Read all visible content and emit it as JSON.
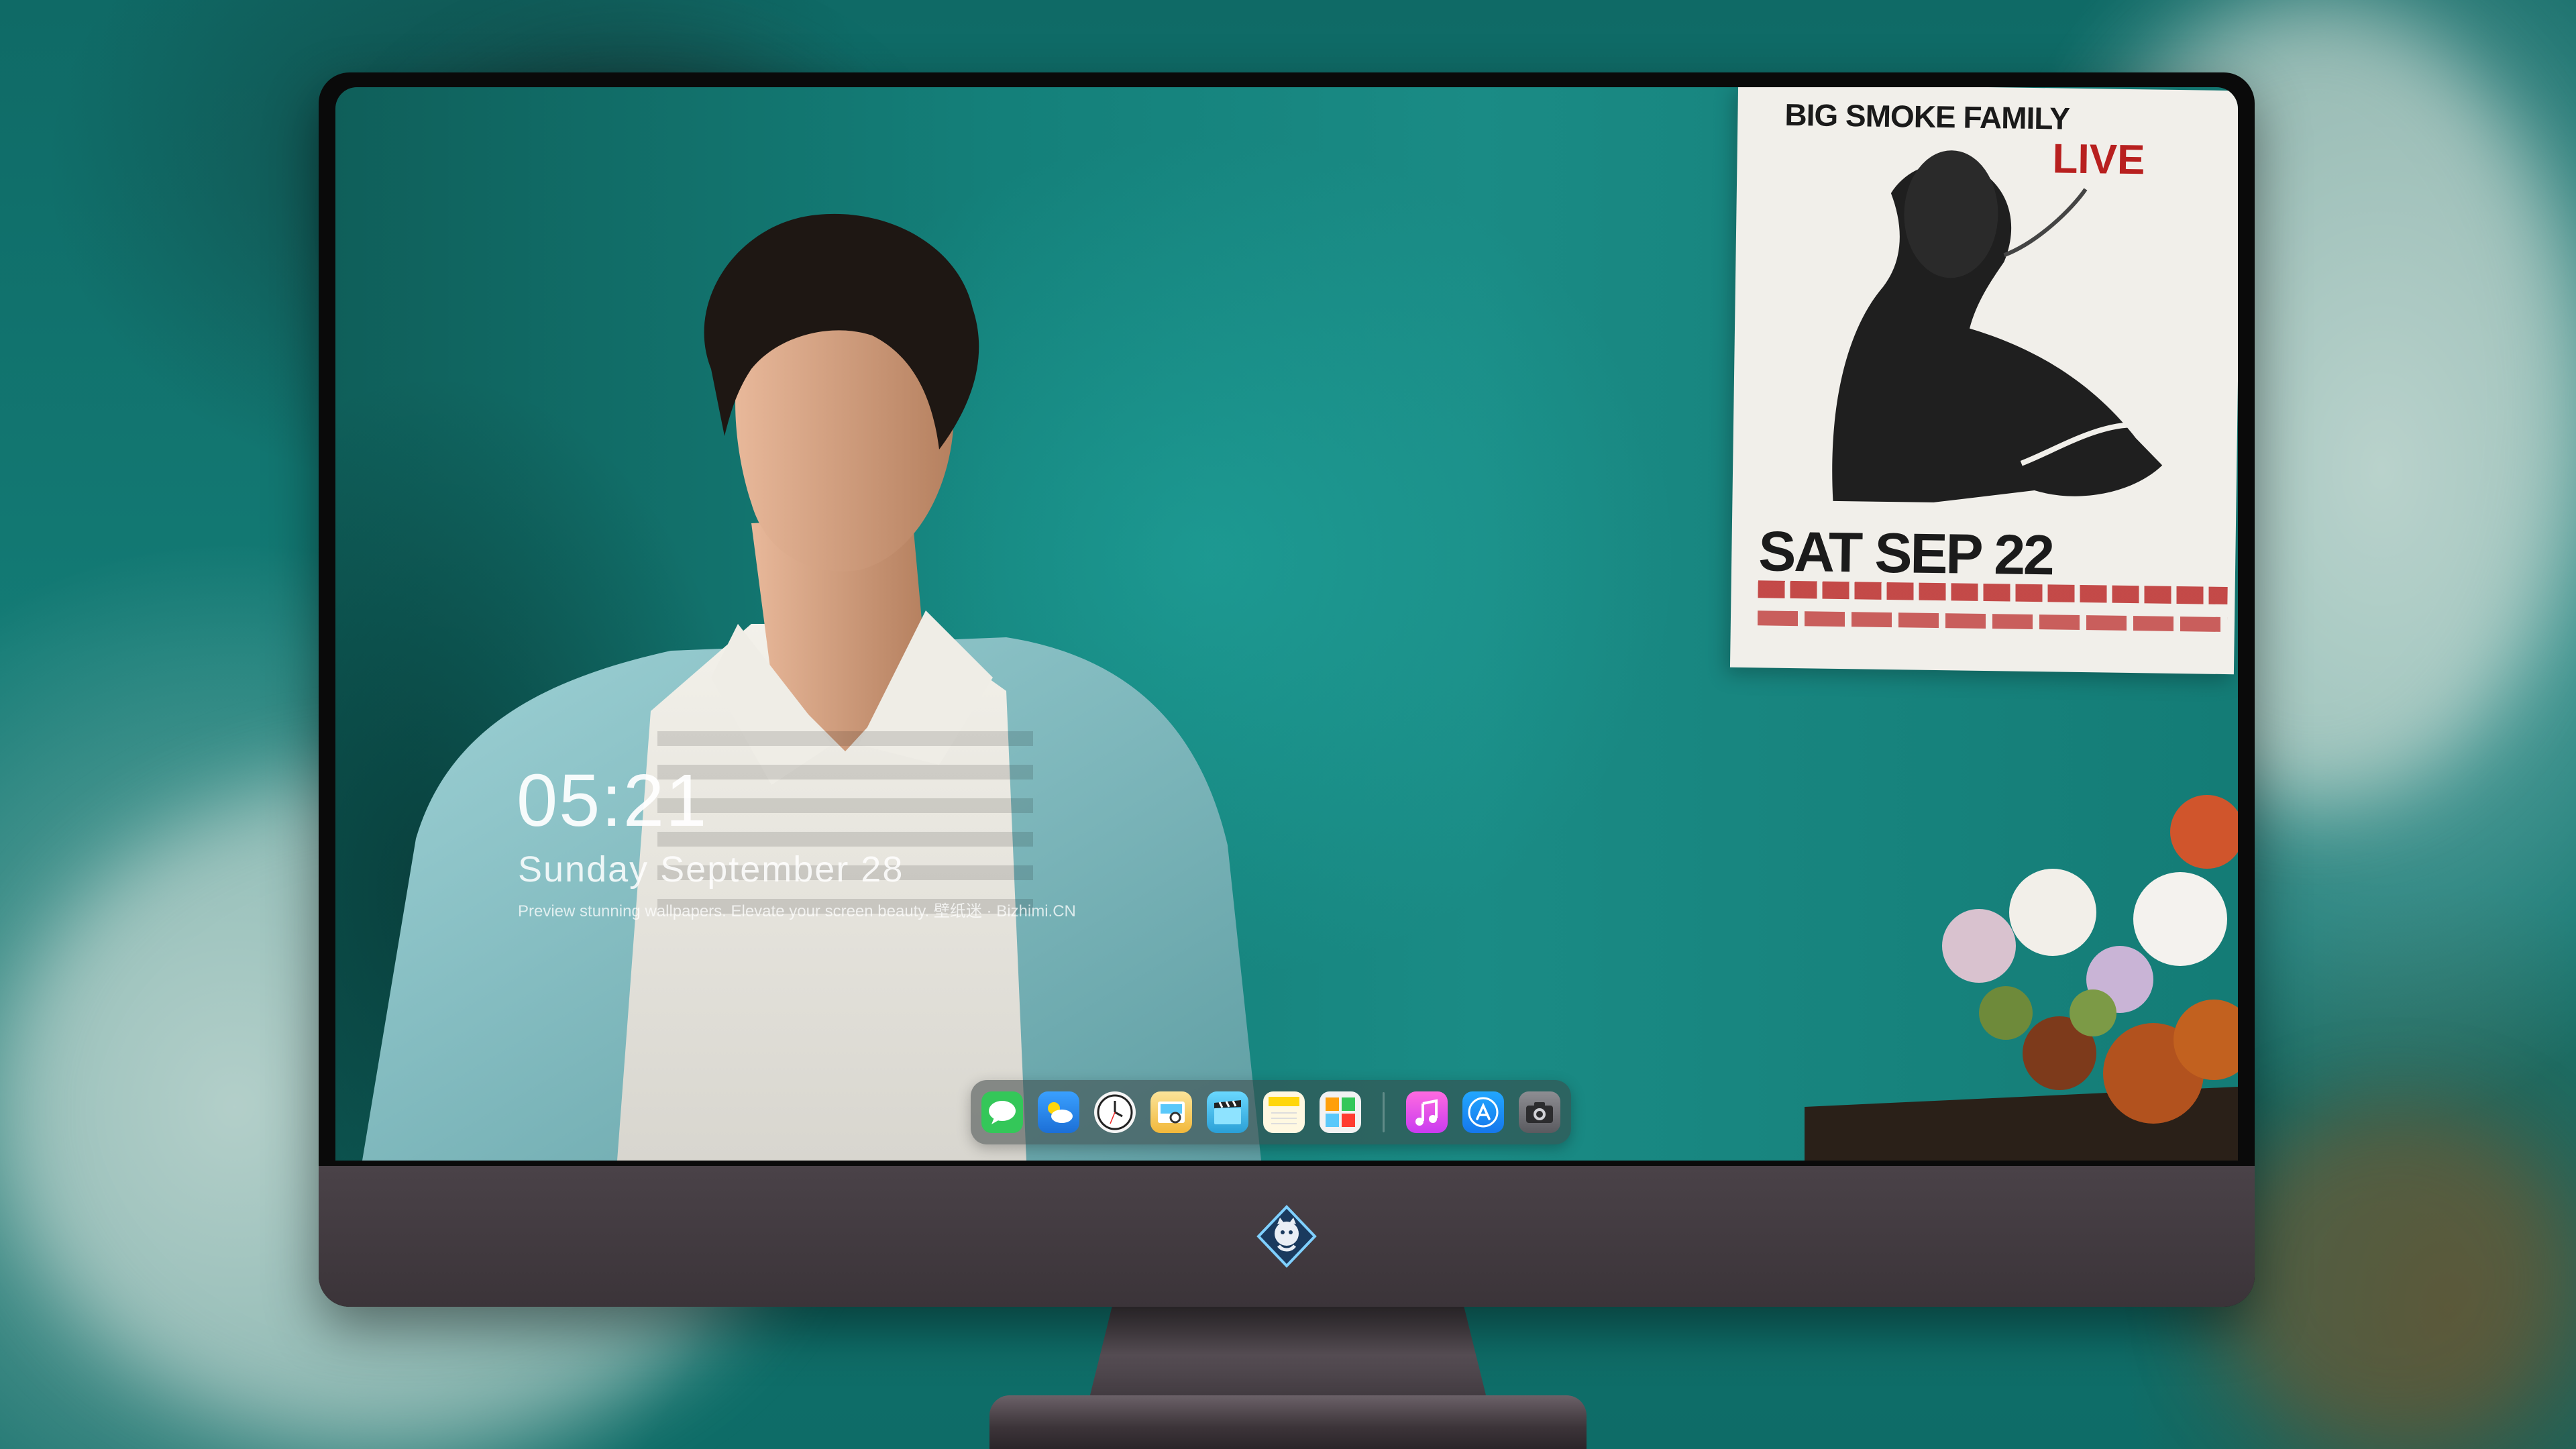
{
  "lock_screen": {
    "time": "05:21",
    "date": "Sunday September  28",
    "caption": "Preview stunning wallpapers. Elevate your screen beauty. 壁纸迷 · Bizhimi.CN"
  },
  "poster": {
    "title": "BIG SMOKE FAMILY",
    "live": "LIVE",
    "date": "SAT SEP 22"
  },
  "dock": {
    "apps": [
      {
        "name": "Messages",
        "icon": "messages-icon",
        "color": "#34c759"
      },
      {
        "name": "Weather",
        "icon": "weather-icon",
        "color": "#2f8ff0"
      },
      {
        "name": "Clock",
        "icon": "clock-icon",
        "color": "#ffffff"
      },
      {
        "name": "Preview",
        "icon": "preview-icon",
        "color": "#f5c542"
      },
      {
        "name": "Final Cut",
        "icon": "clapper-icon",
        "color": "#5ac8fa"
      },
      {
        "name": "Notes",
        "icon": "notes-icon",
        "color": "#ffd60a"
      },
      {
        "name": "Photo Booth",
        "icon": "photo-booth-icon",
        "color": "#ff9f0a"
      },
      {
        "name": "Music",
        "icon": "music-icon",
        "color": "#ff4fd8"
      },
      {
        "name": "App Store",
        "icon": "app-store-icon",
        "color": "#1d8cf8"
      },
      {
        "name": "Camera",
        "icon": "camera-icon",
        "color": "#6e6e73"
      }
    ]
  },
  "colors": {
    "wall": "#14807a",
    "monitor_chin": "#3b3439",
    "dock_bg": "rgba(60,70,70,0.55)"
  }
}
